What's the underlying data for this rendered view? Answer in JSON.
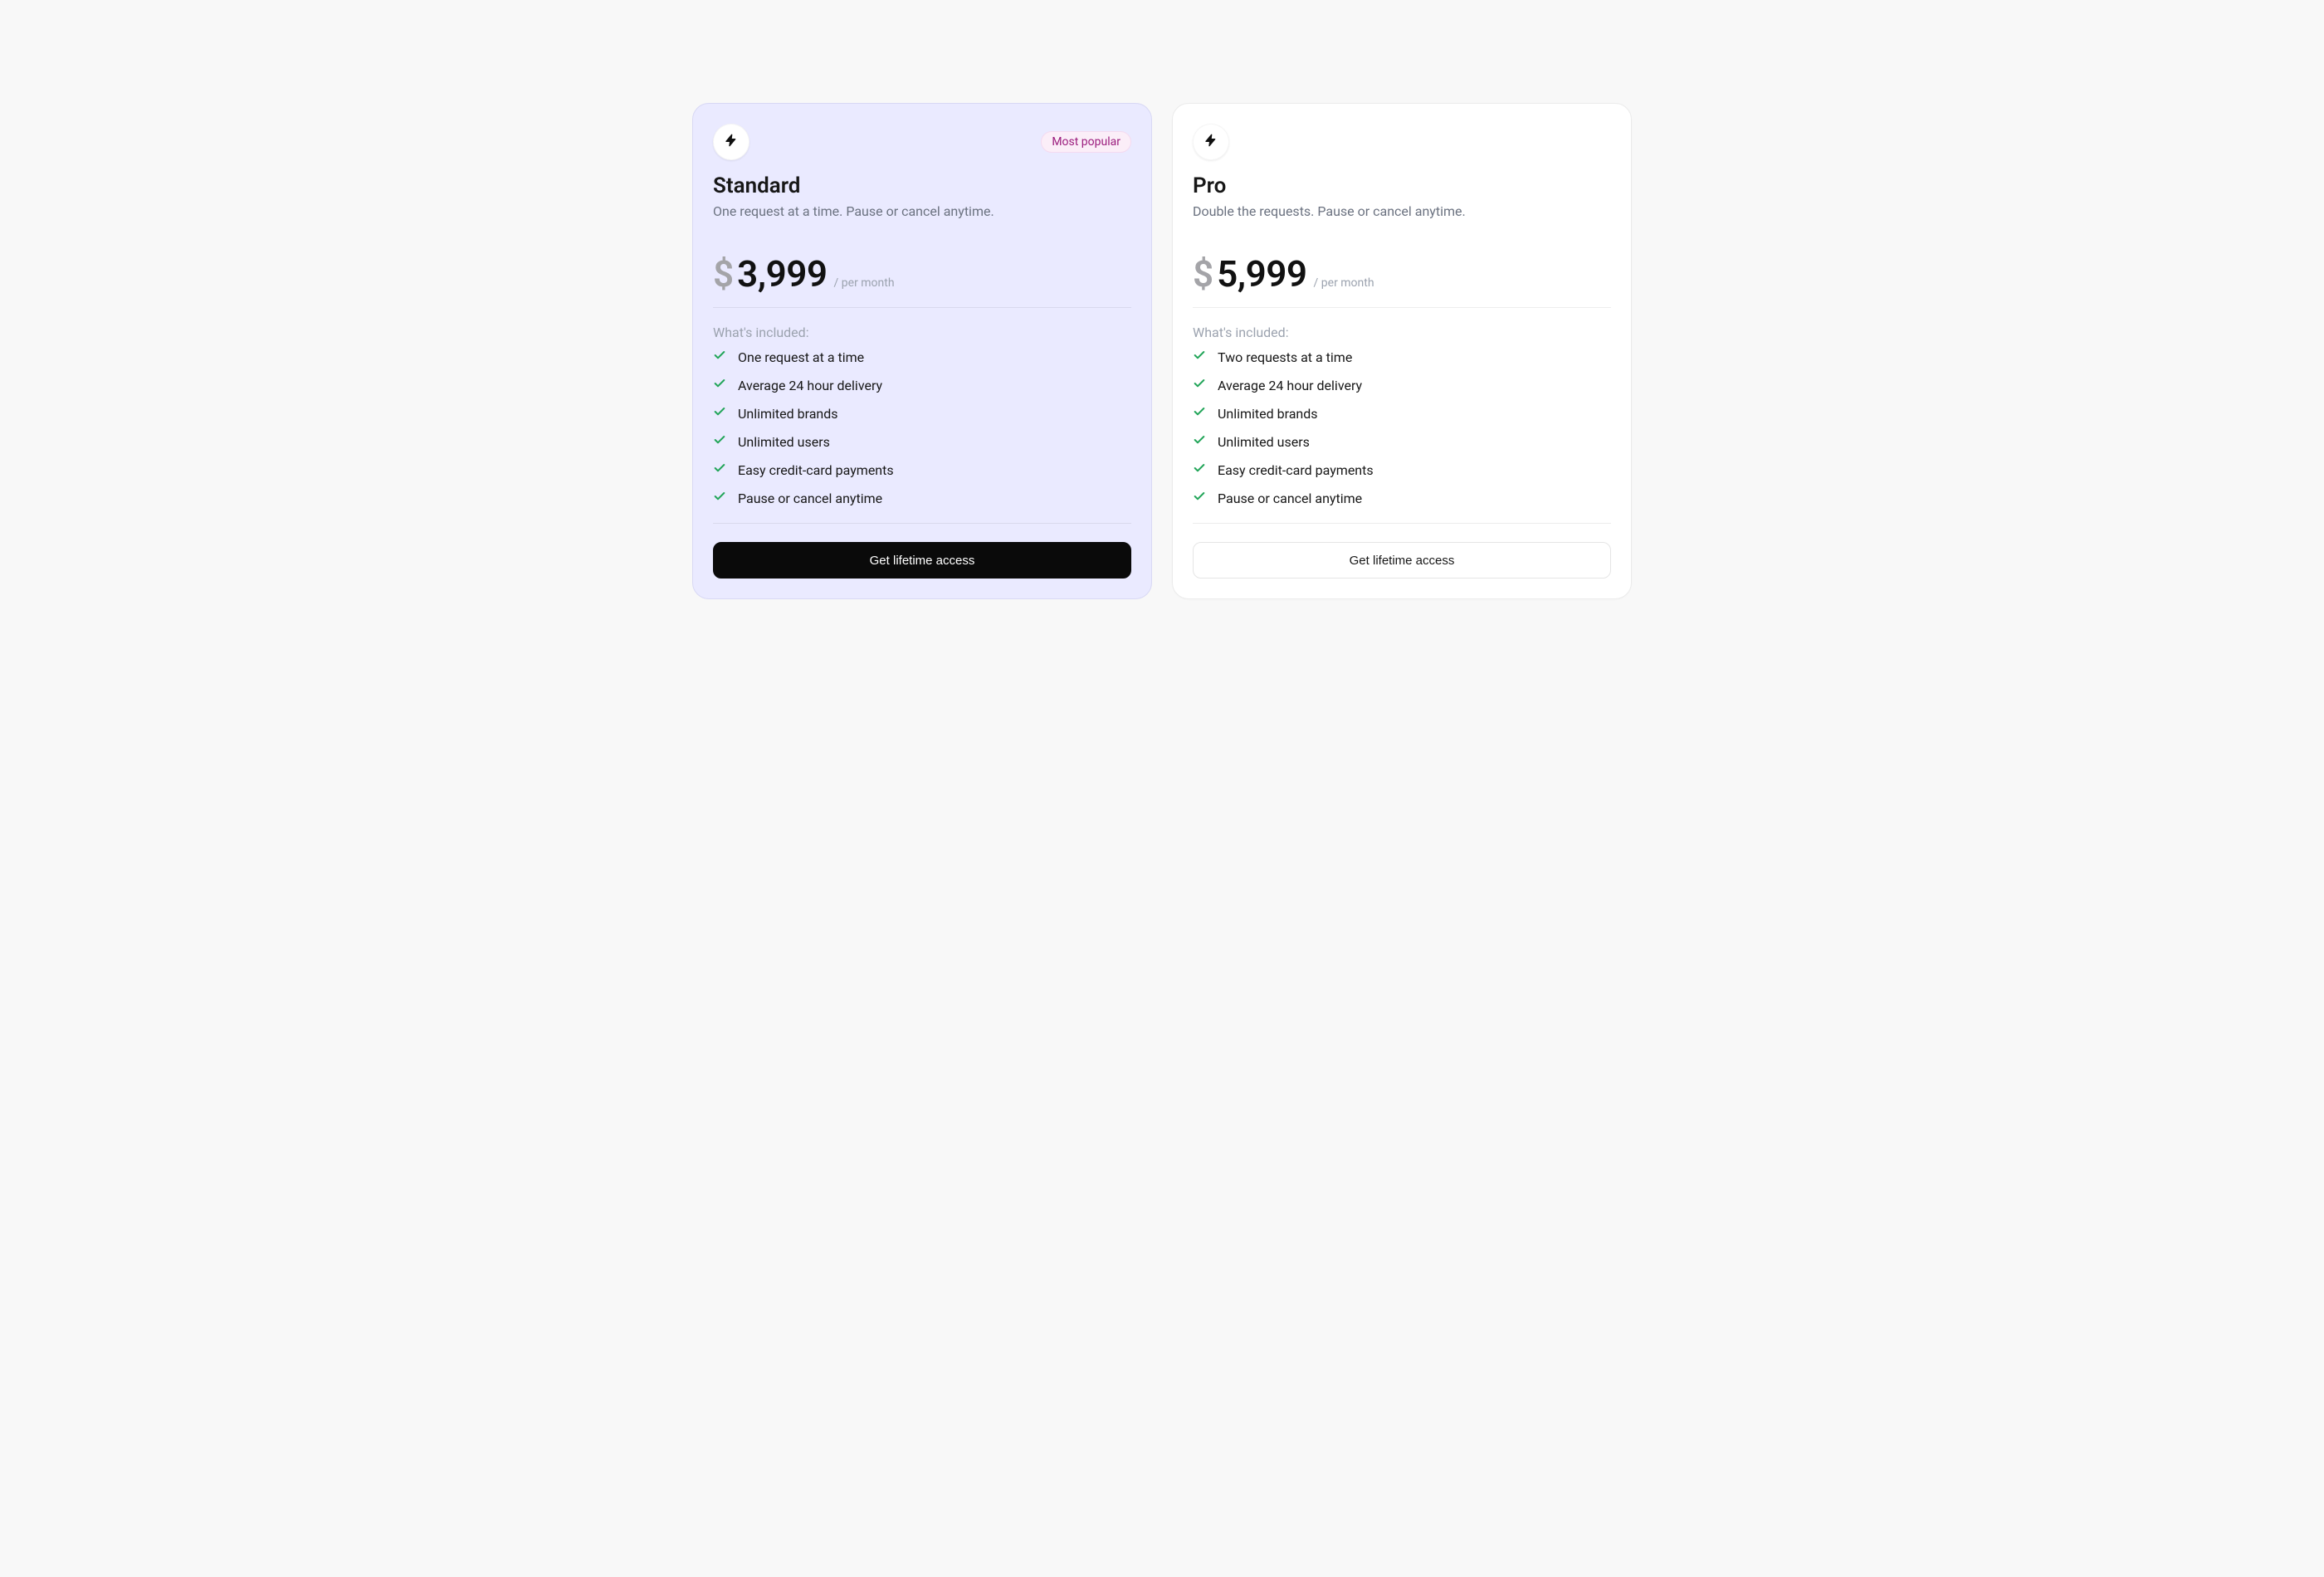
{
  "plans": [
    {
      "id": "standard",
      "popular": true,
      "badge": "Most popular",
      "name": "Standard",
      "subtitle": "One request at a time. Pause or cancel anytime.",
      "currency": "$",
      "amount": "3,999",
      "period": "/ per month",
      "included_label": "What's included:",
      "features": [
        "One request at a time",
        "Average 24 hour delivery",
        "Unlimited brands",
        "Unlimited users",
        "Easy credit-card payments",
        "Pause or cancel anytime"
      ],
      "cta": "Get lifetime access"
    },
    {
      "id": "pro",
      "popular": false,
      "name": "Pro",
      "subtitle": "Double the requests. Pause or cancel anytime.",
      "currency": "$",
      "amount": "5,999",
      "period": "/ per month",
      "included_label": "What's included:",
      "features": [
        "Two requests at a time",
        "Average 24 hour delivery",
        "Unlimited brands",
        "Unlimited users",
        "Easy credit-card payments",
        "Pause or cancel anytime"
      ],
      "cta": "Get lifetime access"
    }
  ]
}
